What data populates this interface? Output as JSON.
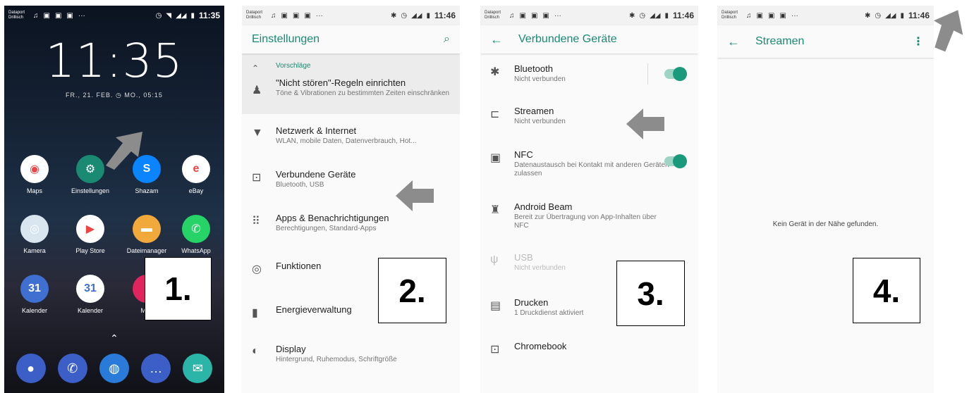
{
  "status": {
    "carrier": "Dataport\nDrillisch",
    "time_p1": "11:35",
    "time_other": "11:46"
  },
  "panel1": {
    "clock": "11:35",
    "date": "FR., 21. FEB.  ◷ MO., 05:15",
    "apps": [
      {
        "label": "Maps",
        "icon": "maps-icon",
        "color": "#ffffff"
      },
      {
        "label": "Einstellungen",
        "icon": "gear-icon",
        "color": "#1a8a72"
      },
      {
        "label": "Shazam",
        "icon": "shazam-icon",
        "color": "#0a84ff"
      },
      {
        "label": "eBay",
        "icon": "ebay-icon",
        "color": "#ffffff"
      },
      {
        "label": "Kamera",
        "icon": "camera-icon",
        "color": "#d9e6ef"
      },
      {
        "label": "Play Store",
        "icon": "play-store-icon",
        "color": "#ffffff"
      },
      {
        "label": "Dateimanager",
        "icon": "folder-icon",
        "color": "#f2a93b"
      },
      {
        "label": "WhatsApp",
        "icon": "whatsapp-icon",
        "color": "#25d366"
      },
      {
        "label": "Kalender",
        "icon": "calendar-icon",
        "color": "#3f6fd1"
      },
      {
        "label": "Kalender",
        "icon": "calendar-icon",
        "color": "#ffffff"
      },
      {
        "label": "Mus",
        "icon": "music-icon",
        "color": "#e0245e"
      }
    ],
    "calendar_day": "31",
    "dock": [
      {
        "icon": "contacts-icon",
        "color": "#3b5fc7"
      },
      {
        "icon": "phone-icon",
        "color": "#3b5fc7"
      },
      {
        "icon": "browser-icon",
        "color": "#2a7bd9"
      },
      {
        "icon": "messages-icon",
        "color": "#3b5fc7"
      },
      {
        "icon": "mail-icon",
        "color": "#2bb5a8"
      }
    ],
    "number": "1."
  },
  "panel2": {
    "title": "Einstellungen",
    "suggest_label": "Vorschläge",
    "items": [
      {
        "title": "\"Nicht stören\"-Regeln einrichten",
        "sub": "Töne & Vibrationen zu bestimmten Zeiten einschränken",
        "icon": "bell-icon"
      },
      {
        "title": "Netzwerk & Internet",
        "sub": "WLAN, mobile Daten, Datenverbrauch, Hot...",
        "icon": "wifi-icon"
      },
      {
        "title": "Verbundene Geräte",
        "sub": "Bluetooth, USB",
        "icon": "devices-icon"
      },
      {
        "title": "Apps & Benachrichtigungen",
        "sub": "Berechtigungen, Standard-Apps",
        "icon": "apps-grid-icon"
      },
      {
        "title": "Funktionen",
        "sub": "",
        "icon": "features-icon"
      },
      {
        "title": "Energieverwaltung",
        "sub": "",
        "icon": "battery-icon"
      },
      {
        "title": "Display",
        "sub": "Hintergrund, Ruhemodus, Schriftgröße",
        "icon": "brightness-icon"
      }
    ],
    "number": "2."
  },
  "panel3": {
    "title": "Verbundene Geräte",
    "items": [
      {
        "title": "Bluetooth",
        "sub": "Nicht verbunden",
        "icon": "bluetooth-icon"
      },
      {
        "title": "Streamen",
        "sub": "Nicht verbunden",
        "icon": "cast-icon"
      },
      {
        "title": "NFC",
        "sub": "Datenaustausch bei Kontakt mit anderen Geräten zulassen",
        "icon": "nfc-icon"
      },
      {
        "title": "Android Beam",
        "sub": "Bereit zur Übertragung von App-Inhalten über NFC",
        "icon": "android-icon"
      },
      {
        "title": "USB",
        "sub": "Nicht verbunden",
        "icon": "usb-icon"
      },
      {
        "title": "Drucken",
        "sub": "1 Druckdienst aktiviert",
        "icon": "printer-icon"
      },
      {
        "title": "Chromebook",
        "sub": "",
        "icon": "laptop-icon"
      }
    ],
    "number": "3."
  },
  "panel4": {
    "title": "Streamen",
    "empty": "Kein Gerät in der Nähe gefunden.",
    "number": "4."
  },
  "colors": {
    "accent": "#1a8a72",
    "arrow": "#8c8c8c"
  }
}
